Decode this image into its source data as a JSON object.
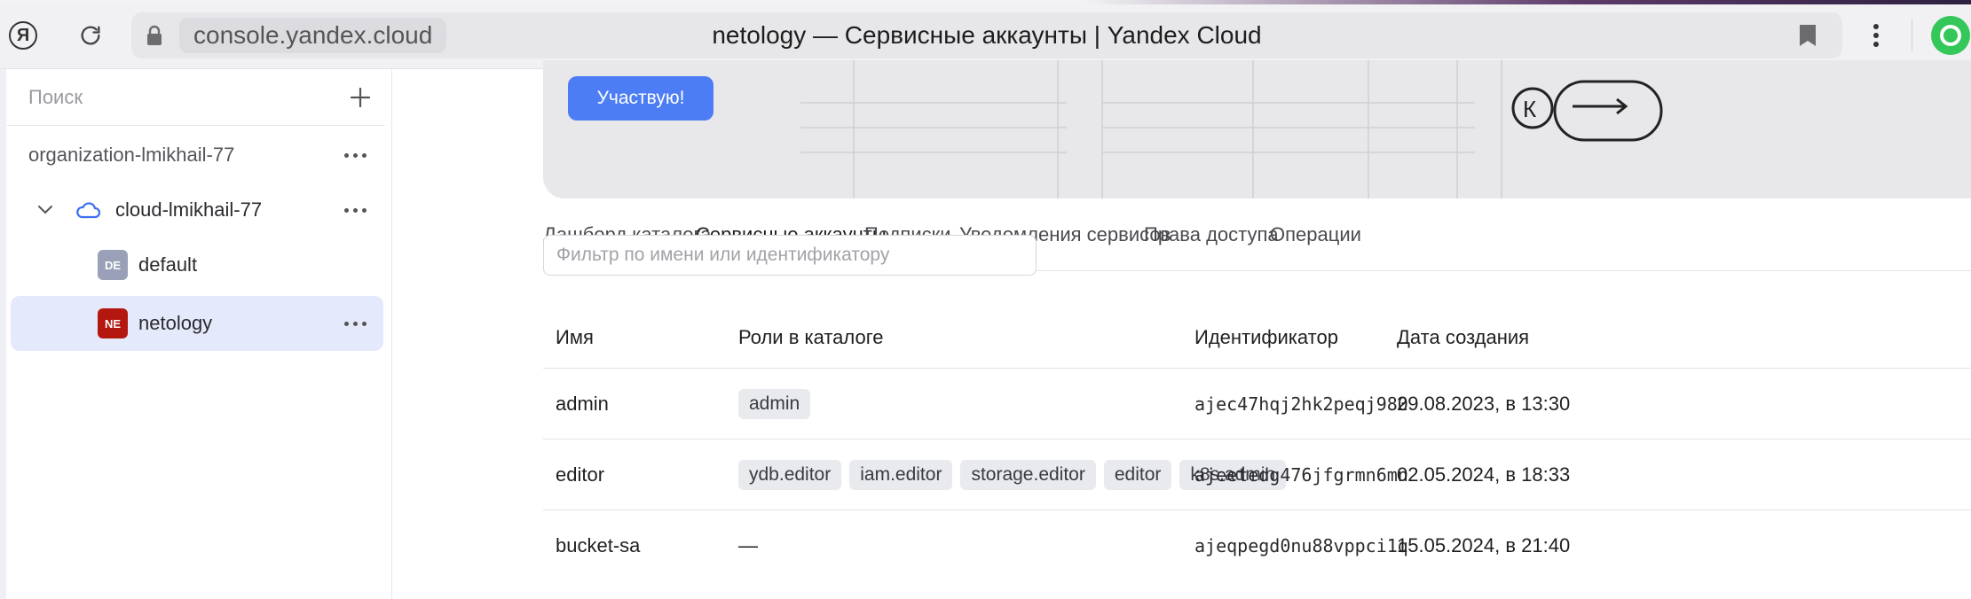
{
  "browser": {
    "url": "console.yandex.cloud",
    "title": "netology — Сервисные аккаунты | Yandex Cloud",
    "ya_glyph": "Я"
  },
  "sidebar": {
    "search_placeholder": "Поиск",
    "organization": "organization-lmikhail-77",
    "cloud": "cloud-lmikhail-77",
    "folders": [
      {
        "badge": "DE",
        "name": "default",
        "badge_color": "#9aa0b8"
      },
      {
        "badge": "NE",
        "name": "netology",
        "badge_color": "#b3170f"
      }
    ]
  },
  "promo": {
    "button_label": "Участвую!"
  },
  "tabs": [
    {
      "label": "Дашборд каталога"
    },
    {
      "label": "Сервисные аккаунты"
    },
    {
      "label": "Подписки"
    },
    {
      "label": "Уведомления сервисов"
    },
    {
      "label": "Права доступа"
    },
    {
      "label": "Операции"
    }
  ],
  "filter": {
    "placeholder": "Фильтр по имени или идентификатору"
  },
  "table": {
    "headers": [
      "Имя",
      "Роли в каталоге",
      "Идентификатор",
      "Дата создания"
    ],
    "rows": [
      {
        "name": "admin",
        "roles": [
          "admin"
        ],
        "id": "ajec47hqj2hk2peqj980",
        "created": "29.08.2023, в 13:30"
      },
      {
        "name": "editor",
        "roles": [
          "ydb.editor",
          "iam.editor",
          "storage.editor",
          "editor",
          "k8s.admin"
        ],
        "id": "ajeetedg476jfgrmn6mn",
        "created": "02.05.2024, в 18:33"
      },
      {
        "name": "bucket-sa",
        "roles_text": "—",
        "id": "ajeqpegd0nu88vppci1q",
        "created": "15.05.2024, в 21:40"
      }
    ]
  },
  "colors": {
    "accent": "#3a6df0",
    "active_bg": "#e4e9fb",
    "promo_button": "#4c7df5"
  }
}
